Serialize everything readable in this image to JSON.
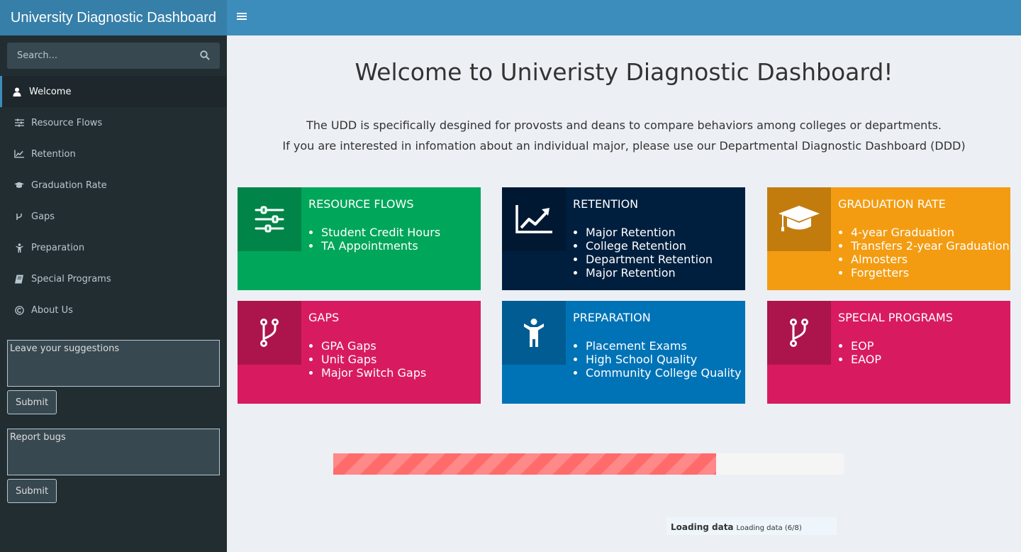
{
  "header": {
    "title": "University Diagnostic Dashboard",
    "toggle_icon": "hamburger-icon"
  },
  "sidebar": {
    "search": {
      "placeholder": "Search...",
      "icon": "search-icon"
    },
    "items": [
      {
        "label": "Welcome",
        "icon": "user-icon",
        "active": true
      },
      {
        "label": "Resource Flows",
        "icon": "sliders-icon"
      },
      {
        "label": "Retention",
        "icon": "line-chart-icon"
      },
      {
        "label": "Graduation Rate",
        "icon": "graduation-cap-icon"
      },
      {
        "label": "Gaps",
        "icon": "code-fork-icon"
      },
      {
        "label": "Preparation",
        "icon": "child-icon"
      },
      {
        "label": "Special Programs",
        "icon": "book-icon"
      },
      {
        "label": "About Us",
        "icon": "copyright-icon"
      }
    ],
    "suggestions": {
      "placeholder": "Leave your suggestions",
      "submit": "Submit"
    },
    "bugs": {
      "placeholder": "Report bugs",
      "submit": "Submit"
    }
  },
  "main": {
    "title": "Welcome to Univeristy Diagnostic Dashboard!",
    "intro": [
      "The UDD is specifically desgined for provosts and deans to compare behaviors among colleges or departments.",
      "If you are interested in infomation about an individual major, please use our Departmental Diagnostic Dashboard (DDD)"
    ],
    "cards": [
      {
        "title": "Resource Flows",
        "icon": "sliders-icon",
        "color": "#00a65a",
        "items": [
          "Student Credit Hours",
          "TA Appointments"
        ]
      },
      {
        "title": "Retention",
        "icon": "line-chart-icon",
        "color": "#001f3f",
        "items": [
          "Major Retention",
          "College Retention",
          "Department Retention",
          "Major Retention"
        ]
      },
      {
        "title": "Graduation Rate",
        "icon": "graduation-cap-icon",
        "color": "#f39c12",
        "items": [
          "4-year Graduation",
          "Transfers 2-year Graduation",
          "Almosters",
          "Forgetters"
        ]
      },
      {
        "title": "Gaps",
        "icon": "code-fork-icon",
        "color": "#d81b60",
        "items": [
          "GPA Gaps",
          "Unit Gaps",
          "Major Switch Gaps"
        ]
      },
      {
        "title": "Preparation",
        "icon": "child-icon",
        "color": "#0073b7",
        "items": [
          "Placement Exams",
          "High School Quality",
          "Community College Quality"
        ]
      },
      {
        "title": "Special Programs",
        "icon": "code-fork-icon",
        "color": "#d81b60",
        "items": [
          "EOP",
          "EAOP"
        ]
      }
    ],
    "progress": {
      "fraction": 0.75,
      "color": "#ff6b6b"
    },
    "loading": {
      "label": "Loading data",
      "detail": "Loading data (6/8)"
    }
  }
}
